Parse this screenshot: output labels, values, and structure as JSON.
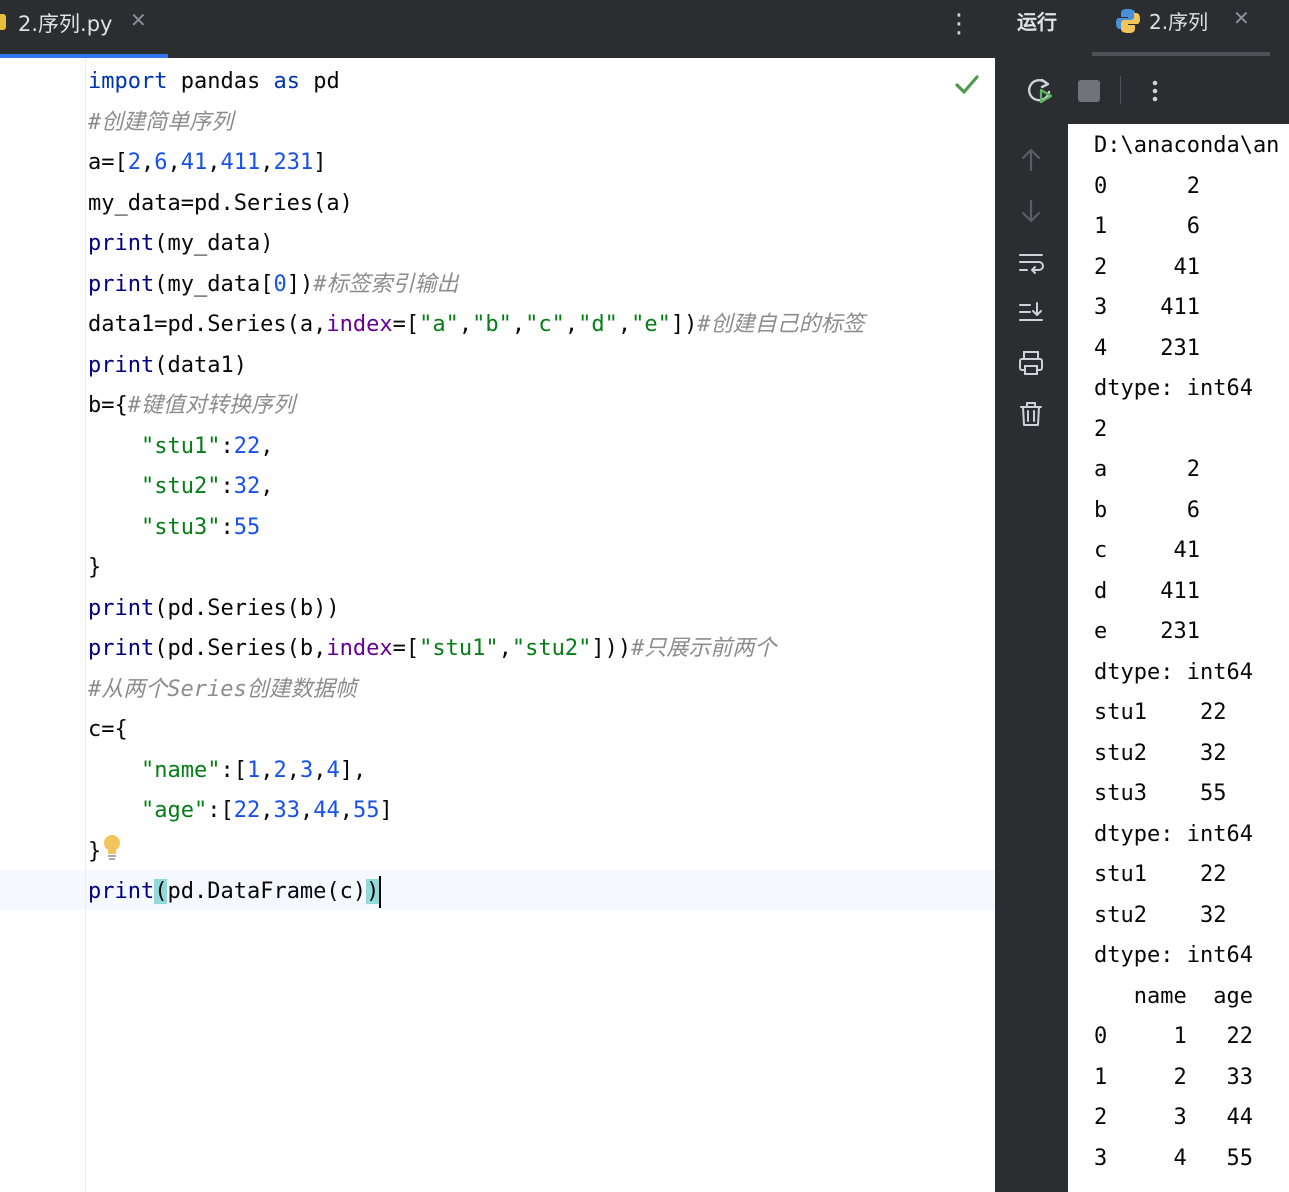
{
  "editor": {
    "tab": {
      "title": "2.序列.py",
      "close": "✕"
    },
    "more_icon": "more-vertical-icon",
    "code_lines": [
      [
        {
          "t": "import",
          "c": "kw"
        },
        {
          "t": " pandas ",
          "c": ""
        },
        {
          "t": "as",
          "c": "kw"
        },
        {
          "t": " pd",
          "c": ""
        }
      ],
      [
        {
          "t": "#创建简单序列",
          "c": "cm"
        }
      ],
      [
        {
          "t": "a=[",
          "c": ""
        },
        {
          "t": "2",
          "c": "num"
        },
        {
          "t": ",",
          "c": ""
        },
        {
          "t": "6",
          "c": "num"
        },
        {
          "t": ",",
          "c": ""
        },
        {
          "t": "41",
          "c": "num"
        },
        {
          "t": ",",
          "c": ""
        },
        {
          "t": "411",
          "c": "num"
        },
        {
          "t": ",",
          "c": ""
        },
        {
          "t": "231",
          "c": "num"
        },
        {
          "t": "]",
          "c": ""
        }
      ],
      [
        {
          "t": "my_data=pd.Series(a)",
          "c": ""
        }
      ],
      [
        {
          "t": "print",
          "c": "fn"
        },
        {
          "t": "(my_data)",
          "c": ""
        }
      ],
      [
        {
          "t": "print",
          "c": "fn"
        },
        {
          "t": "(my_data[",
          "c": ""
        },
        {
          "t": "0",
          "c": "num"
        },
        {
          "t": "])",
          "c": ""
        },
        {
          "t": "#标签索引输出",
          "c": "cm"
        }
      ],
      [
        {
          "t": "data1=pd.Series(a,",
          "c": ""
        },
        {
          "t": "index",
          "c": "prm"
        },
        {
          "t": "=[",
          "c": ""
        },
        {
          "t": "\"a\"",
          "c": "str"
        },
        {
          "t": ",",
          "c": ""
        },
        {
          "t": "\"b\"",
          "c": "str"
        },
        {
          "t": ",",
          "c": ""
        },
        {
          "t": "\"c\"",
          "c": "str"
        },
        {
          "t": ",",
          "c": ""
        },
        {
          "t": "\"d\"",
          "c": "str"
        },
        {
          "t": ",",
          "c": ""
        },
        {
          "t": "\"e\"",
          "c": "str"
        },
        {
          "t": "])",
          "c": ""
        },
        {
          "t": "#创建自己的标签",
          "c": "cm"
        }
      ],
      [
        {
          "t": "print",
          "c": "fn"
        },
        {
          "t": "(data1)",
          "c": ""
        }
      ],
      [
        {
          "t": "b={",
          "c": ""
        },
        {
          "t": "#键值对转换序列",
          "c": "cm"
        }
      ],
      [
        {
          "t": "    ",
          "c": ""
        },
        {
          "t": "\"stu1\"",
          "c": "str"
        },
        {
          "t": ":",
          "c": ""
        },
        {
          "t": "22",
          "c": "num"
        },
        {
          "t": ",",
          "c": ""
        }
      ],
      [
        {
          "t": "    ",
          "c": ""
        },
        {
          "t": "\"stu2\"",
          "c": "str"
        },
        {
          "t": ":",
          "c": ""
        },
        {
          "t": "32",
          "c": "num"
        },
        {
          "t": ",",
          "c": ""
        }
      ],
      [
        {
          "t": "    ",
          "c": ""
        },
        {
          "t": "\"stu3\"",
          "c": "str"
        },
        {
          "t": ":",
          "c": ""
        },
        {
          "t": "55",
          "c": "num"
        }
      ],
      [
        {
          "t": "}",
          "c": ""
        }
      ],
      [
        {
          "t": "print",
          "c": "fn"
        },
        {
          "t": "(pd.Series(b))",
          "c": ""
        }
      ],
      [
        {
          "t": "print",
          "c": "fn"
        },
        {
          "t": "(pd.Series(b,",
          "c": ""
        },
        {
          "t": "index",
          "c": "prm"
        },
        {
          "t": "=[",
          "c": ""
        },
        {
          "t": "\"stu1\"",
          "c": "str"
        },
        {
          "t": ",",
          "c": ""
        },
        {
          "t": "\"stu2\"",
          "c": "str"
        },
        {
          "t": "]))",
          "c": ""
        },
        {
          "t": "#只展示前两个",
          "c": "cm"
        }
      ],
      [
        {
          "t": "#从两个Series创建数据帧",
          "c": "cm"
        }
      ],
      [
        {
          "t": "c={",
          "c": ""
        }
      ],
      [
        {
          "t": "    ",
          "c": ""
        },
        {
          "t": "\"name\"",
          "c": "str"
        },
        {
          "t": ":[",
          "c": ""
        },
        {
          "t": "1",
          "c": "num"
        },
        {
          "t": ",",
          "c": ""
        },
        {
          "t": "2",
          "c": "num"
        },
        {
          "t": ",",
          "c": ""
        },
        {
          "t": "3",
          "c": "num"
        },
        {
          "t": ",",
          "c": ""
        },
        {
          "t": "4",
          "c": "num"
        },
        {
          "t": "],",
          "c": ""
        }
      ],
      [
        {
          "t": "    ",
          "c": ""
        },
        {
          "t": "\"age\"",
          "c": "str"
        },
        {
          "t": ":[",
          "c": ""
        },
        {
          "t": "22",
          "c": "num"
        },
        {
          "t": ",",
          "c": ""
        },
        {
          "t": "33",
          "c": "num"
        },
        {
          "t": ",",
          "c": ""
        },
        {
          "t": "44",
          "c": "num"
        },
        {
          "t": ",",
          "c": ""
        },
        {
          "t": "55",
          "c": "num"
        },
        {
          "t": "]",
          "c": ""
        }
      ],
      [
        {
          "t": "}",
          "c": ""
        }
      ],
      [
        {
          "t": "print",
          "c": "fn"
        },
        {
          "t": "(",
          "c": "br-hl"
        },
        {
          "t": "pd.DataFrame(c)",
          "c": ""
        },
        {
          "t": ")",
          "c": "br-hl"
        }
      ]
    ]
  },
  "run_panel": {
    "title": "运行",
    "tab": {
      "title": "2.序列",
      "icon": "python-icon",
      "close": "✕"
    },
    "console_lines": [
      "D:\\anaconda\\an",
      "0      2",
      "1      6",
      "2     41",
      "3    411",
      "4    231",
      "dtype: int64",
      "2",
      "a      2",
      "b      6",
      "c     41",
      "d    411",
      "e    231",
      "dtype: int64",
      "stu1    22",
      "stu2    32",
      "stu3    55",
      "dtype: int64",
      "stu1    22",
      "stu2    32",
      "dtype: int64",
      "   name  age",
      "0     1   22",
      "1     2   33",
      "2     3   44",
      "3     4   55"
    ]
  },
  "colors": {
    "keyword": "#0033b3",
    "number": "#1750eb",
    "string": "#067d17",
    "comment": "#8c8c8c",
    "param": "#660099",
    "panel_bg": "#2b2d30"
  }
}
